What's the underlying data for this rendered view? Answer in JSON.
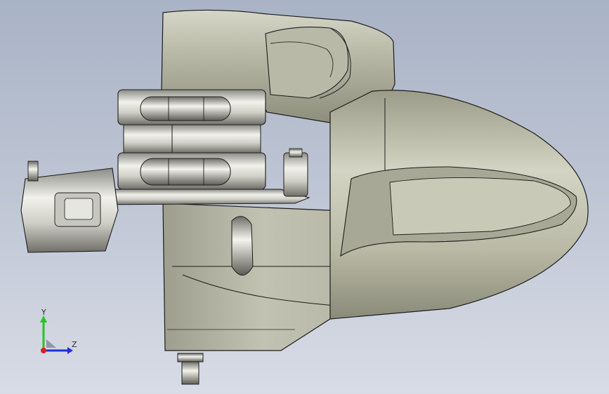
{
  "viewport": {
    "background_top": "#a9b3c6",
    "background_bottom": "#d8dce6"
  },
  "model": {
    "body_color": "#b8b8a8",
    "edge_color": "#1c1c1c",
    "metal_color": "#d9d9d2"
  },
  "triad": {
    "y_label": "Y",
    "z_label": "Z",
    "y_color": "#27c427",
    "z_color": "#2030d8",
    "x_color": "#d82020"
  }
}
